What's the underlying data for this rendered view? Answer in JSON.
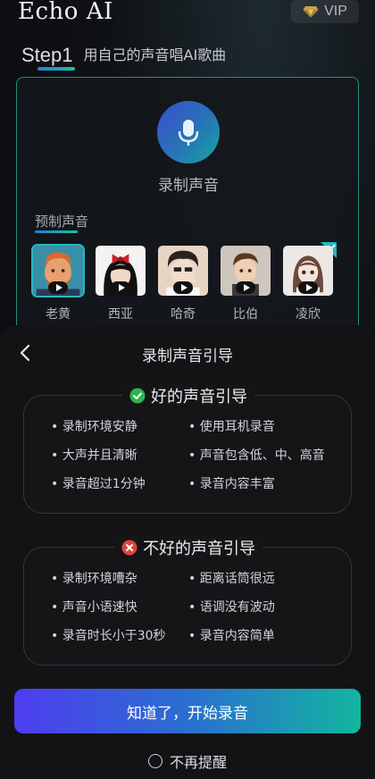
{
  "app": {
    "title": "Echo AI",
    "vip_label": "VIP"
  },
  "step": {
    "label": "Step1",
    "description": "用自己的声音唱AI歌曲"
  },
  "record_panel": {
    "record_label": "录制声音",
    "preset_label": "预制声音",
    "voices": [
      {
        "name": "老黄",
        "selected": true
      },
      {
        "name": "西亚",
        "selected": false
      },
      {
        "name": "哈奇",
        "selected": false
      },
      {
        "name": "比伯",
        "selected": false
      },
      {
        "name": "凌欣",
        "selected": false
      }
    ]
  },
  "sheet": {
    "title": "录制声音引导",
    "good": {
      "heading": "好的声音引导",
      "items": [
        "录制环境安静",
        "使用耳机录音",
        "大声并且清晰",
        "声音包含低、中、高音",
        "录音超过1分钟",
        "录音内容丰富"
      ]
    },
    "bad": {
      "heading": "不好的声音引导",
      "items": [
        "录制环境嘈杂",
        "距离话筒很远",
        "声音小语速快",
        "语调没有波动",
        "录音时长小于30秒",
        "录音内容简单"
      ]
    },
    "start_button": "知道了，开始录音",
    "no_remind": "不再提醒"
  },
  "colors": {
    "good": "#2fb352",
    "bad": "#e0443c",
    "accent": "#23b8c6"
  }
}
